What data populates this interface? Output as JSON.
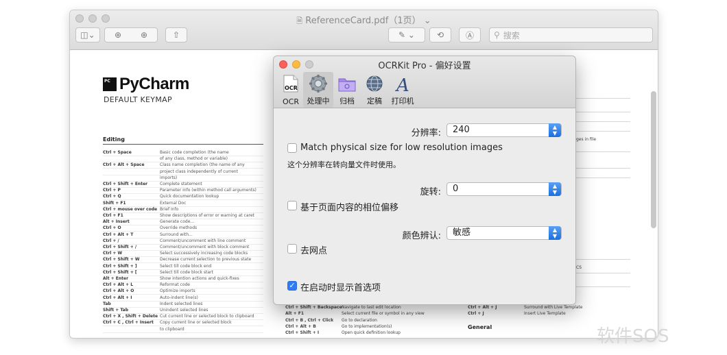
{
  "preview": {
    "title": "ReferenceCard.pdf（1页）",
    "search_placeholder": "搜索",
    "doc": {
      "logo_badge": "PC",
      "logo_text": "PyCharm",
      "subtitle": "DEFAULT KEYMAP",
      "section_editing": "Editing",
      "section_general": "General",
      "rows": [
        {
          "key": "Ctrl + Space",
          "desc": "Basic code completion (the name"
        },
        {
          "key": "",
          "desc": "of any class, method or variable)"
        },
        {
          "key": "Ctrl + Alt + Space",
          "desc": "Class name completion (the name of any"
        },
        {
          "key": "",
          "desc": "project class independently of current"
        },
        {
          "key": "",
          "desc": "imports)"
        },
        {
          "key": "Ctrl + Shift + Enter",
          "desc": "Complete statement"
        },
        {
          "key": "Ctrl + P",
          "desc": "Parameter info (within method call arguments)"
        },
        {
          "key": "Ctrl + Q",
          "desc": "Quick documentation lookup"
        },
        {
          "key": "Shift + F1",
          "desc": "External Doc"
        },
        {
          "key": "Ctrl + mouse over code",
          "desc": "Brief Info"
        },
        {
          "key": "Ctrl + F1",
          "desc": "Show descriptions of error or warning at caret"
        },
        {
          "key": "Alt + Insert",
          "desc": "Generate code..."
        },
        {
          "key": "Ctrl + O",
          "desc": "Override methods"
        },
        {
          "key": "Ctrl + Alt + T",
          "desc": "Surround with..."
        },
        {
          "key": "Ctrl + /",
          "desc": "Comment/uncomment with line comment"
        },
        {
          "key": "Ctrl + Shift + /",
          "desc": "Comment/uncomment with block comment"
        },
        {
          "key": "Ctrl + W",
          "desc": "Select successively increasing code blocks"
        },
        {
          "key": "Ctrl + Shift + W",
          "desc": "Decrease current selection to previous state"
        },
        {
          "key": "Ctrl + Shift + ]",
          "desc": "Select till code block end"
        },
        {
          "key": "Ctrl + Shift + [",
          "desc": "Select till code block start"
        },
        {
          "key": "Alt + Enter",
          "desc": "Show intention actions and quick-fixes"
        },
        {
          "key": "Ctrl + Alt + L",
          "desc": "Reformat code"
        },
        {
          "key": "Ctrl + Alt + O",
          "desc": "Optimize imports"
        },
        {
          "key": "Ctrl + Alt + I",
          "desc": "Auto-indent line(s)"
        },
        {
          "key": "Tab",
          "desc": "Indent selected lines"
        },
        {
          "key": "Shift + Tab",
          "desc": "Unindent selected lines"
        },
        {
          "key": "Ctrl + X , Shift + Delete",
          "desc": "Cut current line or selected block to clipboard"
        },
        {
          "key": "Ctrl + C , Ctrl + Insert",
          "desc": "Copy current line or selected block"
        },
        {
          "key": "",
          "desc": "to clipboard"
        }
      ],
      "mid_rows": [
        {
          "key": "Ctrl + Shift + Backspace",
          "desc": "Navigate to last edit location"
        },
        {
          "key": "Alt + F1",
          "desc": "Select current file or symbol in any view"
        },
        {
          "key": "Ctrl + B , Ctrl + Click",
          "desc": "Go to declaration"
        },
        {
          "key": "Ctrl + Alt + B",
          "desc": "Go to implementation(s)"
        },
        {
          "key": "Ctrl + Shift + I",
          "desc": "Open quick definition lookup"
        }
      ],
      "right_rows": [
        {
          "key": "Ctrl + Alt + J",
          "desc": "Surround with Live Template"
        },
        {
          "key": "Ctrl + J",
          "desc": "Insert Live Template"
        }
      ],
      "right_frag_1": "ges in file",
      "right_frag_2": "CS"
    }
  },
  "dialog": {
    "title": "OCRKit Pro - 偏好设置",
    "tabs": [
      {
        "label": "OCR",
        "icon": "ocr-document-icon"
      },
      {
        "label": "处理中",
        "icon": "gear-icon"
      },
      {
        "label": "归档",
        "icon": "folder-icon"
      },
      {
        "label": "定稿",
        "icon": "globe-icon"
      },
      {
        "label": "打印机",
        "icon": "font-a-icon"
      }
    ],
    "active_tab": "处理中",
    "ocr_icon_text": "OCR",
    "font_icon_text": "A",
    "resolution_label": "分辨率:",
    "resolution_value": "240",
    "match_size_label": "Match physical size for low resolution images",
    "match_size_checked": false,
    "resolution_note": "这个分辨率在转向量文件时使用。",
    "rotation_label": "旋转:",
    "rotation_value": "0",
    "phase_offset_label": "基于页面内容的相位偏移",
    "phase_offset_checked": false,
    "color_label": "颜色辨认:",
    "color_value": "敏感",
    "descreen_label": "去网点",
    "descreen_checked": false,
    "show_prefs_label": "在启动时显示首选项",
    "show_prefs_checked": true
  },
  "watermark": "软件SOS",
  "colors": {
    "accent": "#2f7cf6",
    "close": "#fc605c",
    "minimize": "#fdbc40",
    "zoom_inactive": "#cdcdcd"
  }
}
